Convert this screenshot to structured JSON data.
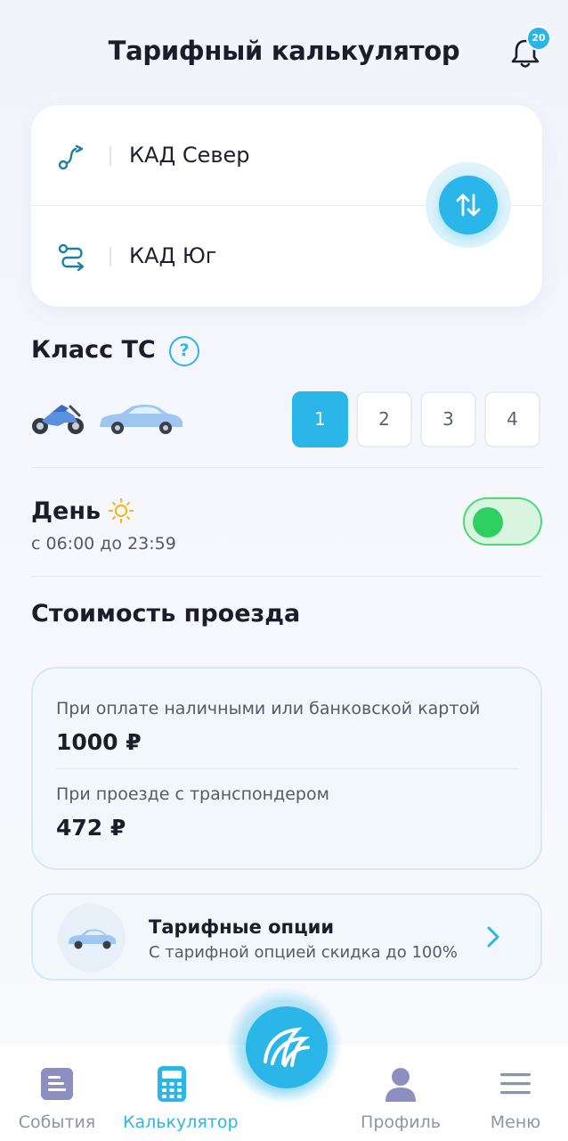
{
  "header": {
    "title": "Тарифный калькулятор",
    "notifications_count": "20"
  },
  "route": {
    "from": "КАД Север",
    "to": "КАД Юг"
  },
  "vehicle_class": {
    "title": "Класс ТС",
    "help_label": "?",
    "options": [
      "1",
      "2",
      "3",
      "4"
    ],
    "selected": "1"
  },
  "time_period": {
    "title": "День",
    "subtitle": "с 06:00 до 23:59",
    "toggle_on": true
  },
  "cost": {
    "title": "Стоимость проезда",
    "cash_label": "При оплате наличными или банковской картой",
    "cash_value": "1000 ₽",
    "transponder_label": "При проезде с транспондером",
    "transponder_value": "472 ₽"
  },
  "tariff_options": {
    "title": "Тарифные опции",
    "subtitle": "С тарифной опцией скидка до 100%"
  },
  "tabbar": {
    "events": "События",
    "calculator": "Калькулятор",
    "profile": "Профиль",
    "menu": "Меню"
  },
  "colors": {
    "accent": "#2ab6e8",
    "toggle": "#2fcf62",
    "text": "#1b1d2b",
    "muted": "#8f95a6"
  }
}
